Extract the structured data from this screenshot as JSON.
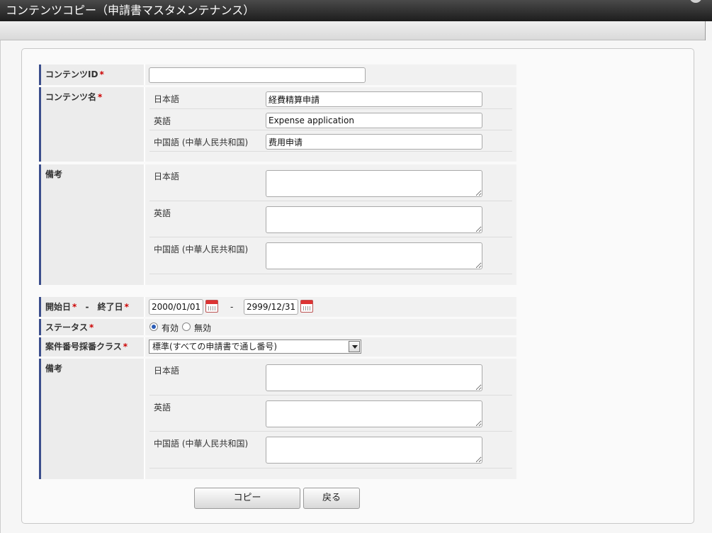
{
  "window": {
    "title": "コンテンツコピー（申請書マスタメンテナンス）"
  },
  "form": {
    "required_mark": "*",
    "content_id": {
      "label": "コンテンツID",
      "value": ""
    },
    "content_name": {
      "label": "コンテンツ名",
      "ja_label": "日本語",
      "ja_value": "経費精算申請",
      "en_label": "英語",
      "en_value": "Expense application",
      "zh_label": "中国語 (中華人民共和国)",
      "zh_value": "费用申请"
    },
    "remarks1": {
      "label": "備考",
      "ja_label": "日本語",
      "en_label": "英語",
      "zh_label": "中国語 (中華人民共和国)"
    },
    "period": {
      "start_label": "開始日",
      "separator": "-",
      "end_label": "終了日",
      "start_value": "2000/01/01",
      "end_value": "2999/12/31",
      "range_dash": "-"
    },
    "status": {
      "label": "ステータス",
      "option_active": "有効",
      "option_inactive": "無効",
      "selected": "有効"
    },
    "numbering": {
      "label": "案件番号採番クラス",
      "selected": "標準(すべての申請書で通し番号)"
    },
    "remarks2": {
      "label": "備考",
      "ja_label": "日本語",
      "en_label": "英語",
      "zh_label": "中国語 (中華人民共和国)"
    }
  },
  "buttons": {
    "copy": "コピー",
    "back": "戻る"
  }
}
